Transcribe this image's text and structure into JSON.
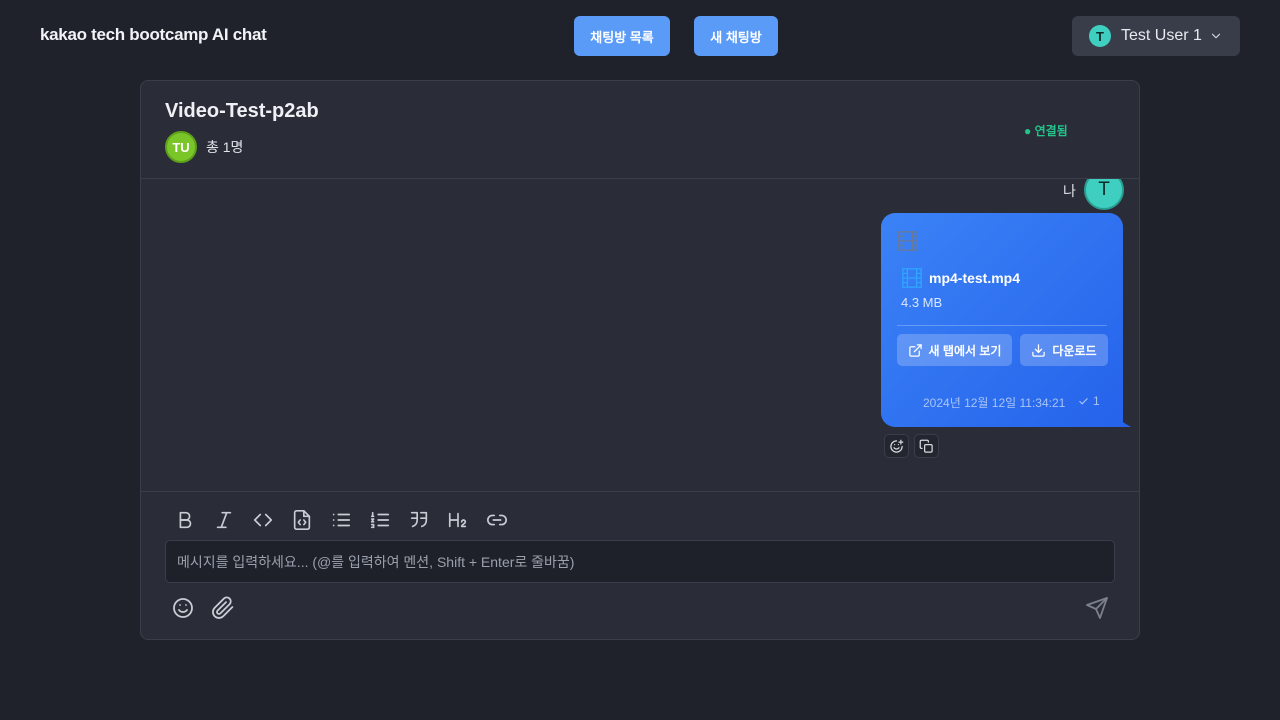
{
  "header": {
    "logo": "kakao tech bootcamp AI chat",
    "chat_list_label": "채팅방 목록",
    "new_chat_label": "새 채팅방",
    "user": {
      "avatar_initial": "T",
      "name": "Test User 1"
    }
  },
  "room": {
    "title": "Video-Test-p2ab",
    "member_avatar": "TU",
    "member_count": "총 1명",
    "status": "● 연결됨"
  },
  "messages": [
    {
      "sender_label": "나",
      "avatar_initial": "T",
      "file_name": "mp4-test.mp4",
      "file_size": "4.3 MB",
      "open_label": "새 탭에서 보기",
      "download_label": "다운로드",
      "timestamp": "2024년 12월 12일 11:34:21",
      "read_count": "1"
    }
  ],
  "composer": {
    "placeholder": "메시지를 입력하세요... (@를 입력하여 멘션, Shift + Enter로 줄바꿈)",
    "value": ""
  },
  "colors": {
    "accent": "#5b9bf8",
    "bubble": "#3b82f6",
    "status": "#22c58b",
    "background": "#1f222b",
    "card": "#2a2d37"
  },
  "icons": [
    "chevron-down-icon",
    "film-icon",
    "external-link-icon",
    "download-icon",
    "check-icon",
    "emoji-add-icon",
    "copy-icon",
    "bold-icon",
    "italic-icon",
    "code-icon",
    "code-block-icon",
    "bullet-list-icon",
    "numbered-list-icon",
    "quote-icon",
    "heading-icon",
    "link-icon",
    "smile-icon",
    "paperclip-icon",
    "send-icon"
  ]
}
